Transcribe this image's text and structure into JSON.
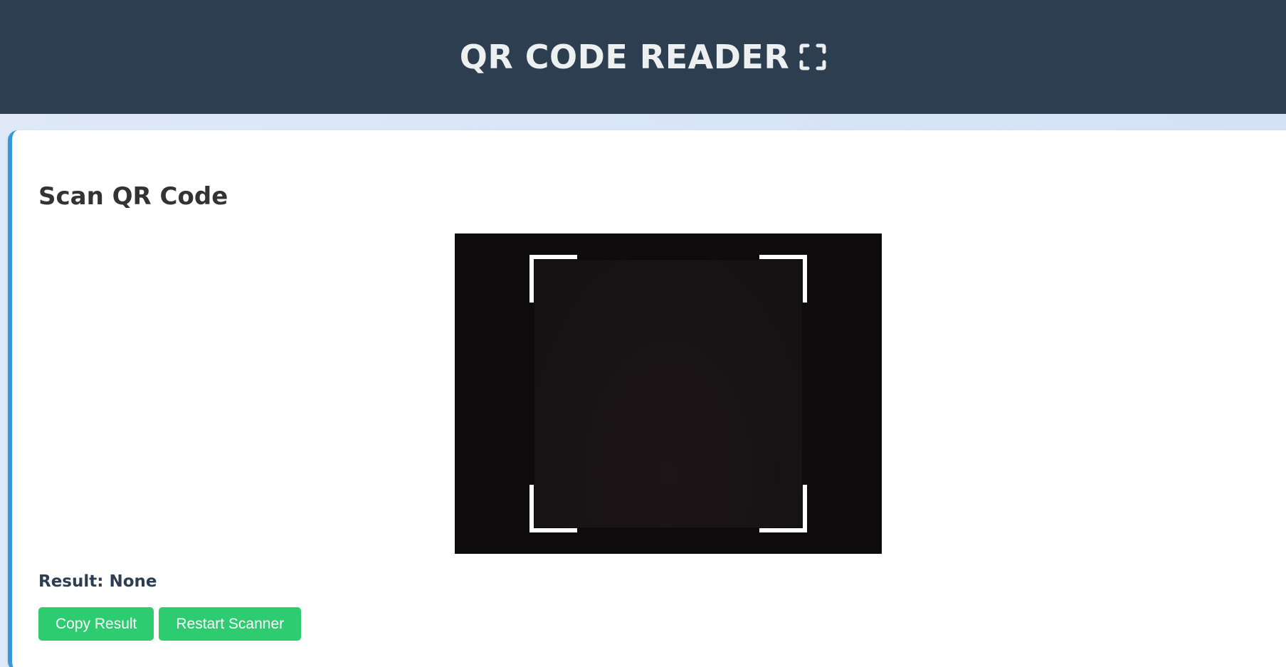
{
  "header": {
    "title": "QR CODE READER",
    "icon": "scan-frame-icon"
  },
  "scanner": {
    "heading": "Scan QR Code",
    "result_label": "Result:",
    "result_value": "None",
    "buttons": {
      "copy": "Copy Result",
      "restart": "Restart Scanner"
    }
  },
  "colors": {
    "header_bg": "#2d3e50",
    "accent": "#3498db",
    "button": "#2ecc71"
  }
}
